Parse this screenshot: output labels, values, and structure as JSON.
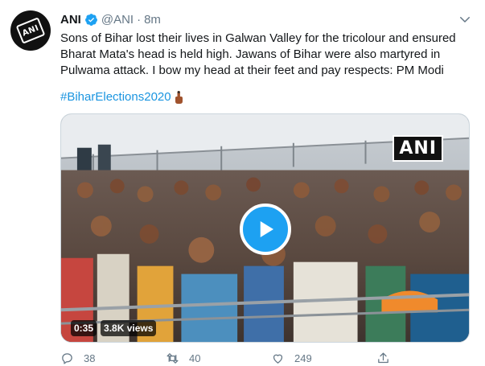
{
  "tweet": {
    "author_name": "ANI",
    "handle": "@ANI",
    "separator": "·",
    "time": "8m",
    "avatar_text": "ANI",
    "text": "Sons of Bihar lost their lives in Galwan Valley for the tricolour and ensured Bharat Mata's head is held high. Jawans of Bihar were also martyred in Pulwama attack. I bow my head at their feet and pay respects: PM Modi",
    "hashtag": "#BiharElections2020"
  },
  "media": {
    "watermark": "ANI",
    "duration": "0:35",
    "views": "3.8K views"
  },
  "actions": {
    "replies": "38",
    "retweets": "40",
    "likes": "249"
  },
  "colors": {
    "accent": "#1da1f2",
    "hashtag": "#1b95e0",
    "muted": "#657786",
    "border": "#ccd6dd"
  },
  "icons": [
    "verified-badge-icon",
    "caret-down-icon",
    "finger-ink-emoji-icon",
    "play-icon",
    "reply-icon",
    "retweet-icon",
    "like-icon",
    "share-icon"
  ]
}
